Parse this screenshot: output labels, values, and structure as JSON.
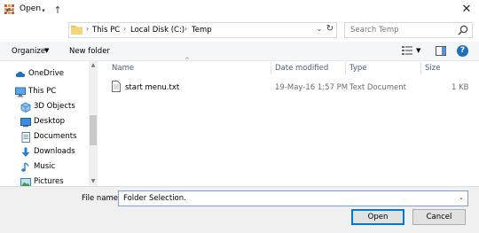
{
  "window": {
    "title": "Open",
    "close_label": "✕"
  },
  "address": {
    "crumbs": [
      "This PC",
      "Local Disk (C:)",
      "Temp"
    ]
  },
  "search": {
    "placeholder": "Search Temp"
  },
  "toolbar": {
    "organize_label": "Organize",
    "new_folder_label": "New folder"
  },
  "sidebar": {
    "items": [
      {
        "label": "OneDrive",
        "icon": "cloud-icon"
      },
      {
        "label": "This PC",
        "icon": "computer-icon"
      },
      {
        "label": "3D Objects",
        "icon": "cube-icon"
      },
      {
        "label": "Desktop",
        "icon": "desktop-icon"
      },
      {
        "label": "Documents",
        "icon": "documents-icon"
      },
      {
        "label": "Downloads",
        "icon": "downloads-icon"
      },
      {
        "label": "Music",
        "icon": "music-icon"
      },
      {
        "label": "Pictures",
        "icon": "pictures-icon"
      }
    ]
  },
  "columns": {
    "name": "Name",
    "date": "Date modified",
    "type": "Type",
    "size": "Size"
  },
  "files": [
    {
      "name": "start menu.txt",
      "date": "19-May-16 1:57 PM",
      "type": "Text Document",
      "size": "1 KB"
    }
  ],
  "footer": {
    "file_name_label": "File name:",
    "file_name_value": "Folder Selection.",
    "open_label": "Open",
    "cancel_label": "Cancel"
  },
  "colors": {
    "accent": "#0078d7",
    "folder": "#e8c25a",
    "header_text": "#4c607a"
  }
}
